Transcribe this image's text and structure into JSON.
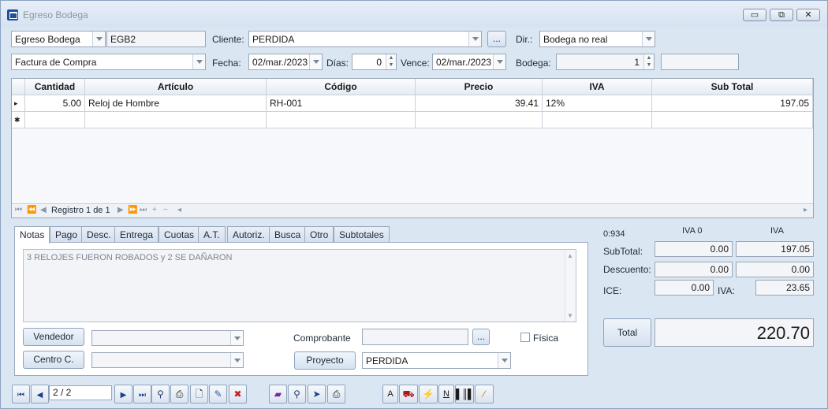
{
  "window": {
    "title": "Egreso Bodega",
    "minimize": "▭",
    "restore": "⧉",
    "close": "✕"
  },
  "header": {
    "doc_type": "Egreso Bodega",
    "doc_code": "EGB2",
    "cliente_label": "Cliente:",
    "cliente": "PERDIDA",
    "ellipsis": "...",
    "dir_label": "Dir.:",
    "dir": "Bodega no real",
    "doc_kind": "Factura de Compra",
    "fecha_label": "Fecha:",
    "fecha": "02/mar./2023",
    "dias_label": "Días:",
    "dias": "0",
    "vence_label": "Vence:",
    "vence": "02/mar./2023",
    "bodega_label": "Bodega:",
    "bodega": "1",
    "bodega_extra": ""
  },
  "grid": {
    "columns": [
      "Cantidad",
      "Artículo",
      "Código",
      "Precio",
      "IVA",
      "Sub Total"
    ],
    "rows": [
      {
        "marker": "▸",
        "cantidad": "5.00",
        "articulo": "Reloj de Hombre",
        "codigo": "RH-001",
        "precio": "39.41",
        "iva": "12%",
        "subtotal": "197.05"
      }
    ],
    "new_row_marker": "✱",
    "nav_record": "Registro 1 de 1"
  },
  "tabs": [
    "Notas",
    "Pago",
    "Desc.",
    "Entrega",
    "Cuotas",
    "A.T.",
    "Autoriz.",
    "Busca",
    "Otro",
    "Subtotales"
  ],
  "notes": {
    "text": "3 RELOJES FUERON ROBADOS y 2 SE DAÑARON"
  },
  "form": {
    "vendedor_btn": "Vendedor",
    "centro_btn": "Centro C.",
    "comprobante_label": "Comprobante",
    "fisica_label": "Física",
    "proyecto_btn": "Proyecto",
    "proyecto": "PERDIDA"
  },
  "totals": {
    "code": "0:934",
    "iva0_header": "IVA 0",
    "iva_header": "IVA",
    "subtotal_label": "SubTotal:",
    "subtotal_iva0": "0.00",
    "subtotal_iva": "197.05",
    "descuento_label": "Descuento:",
    "descuento_iva0": "0.00",
    "descuento_iva": "0.00",
    "ice_label": "ICE:",
    "ice": "0.00",
    "iva_label": "IVA:",
    "iva_value": "23.65",
    "total_btn": "Total",
    "total": "220.70"
  },
  "toolbar": {
    "page": "2 / 2",
    "font_a": "A",
    "n_label": "N"
  }
}
